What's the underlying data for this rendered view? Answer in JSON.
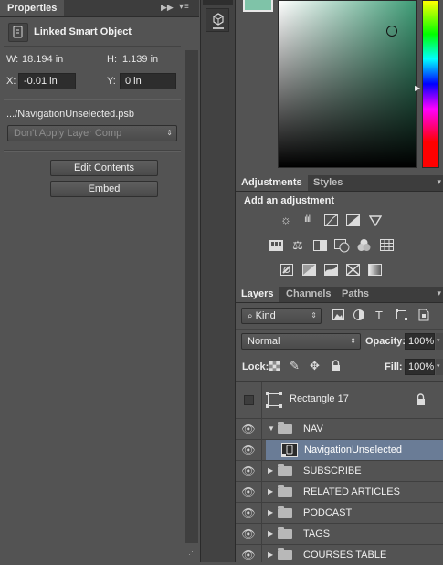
{
  "properties": {
    "tab_label": "Properties",
    "object_type": "Linked Smart Object",
    "w_label": "W:",
    "w_value": "18.194 in",
    "h_label": "H:",
    "h_value": "1.139 in",
    "x_label": "X:",
    "x_value": "-0.01 in",
    "y_label": "Y:",
    "y_value": "0 in",
    "file_name": ".../NavigationUnselected.psb",
    "layer_comp": "Don't Apply Layer Comp",
    "edit_contents_label": "Edit Contents",
    "embed_label": "Embed"
  },
  "adjustments": {
    "tabs": [
      "Adjustments",
      "Styles"
    ],
    "heading": "Add an adjustment",
    "row1": [
      "brightness-icon",
      "levels-icon",
      "curves-icon",
      "exposure-icon",
      "vibrance-icon"
    ],
    "row2": [
      "hue-saturation-icon",
      "color-balance-icon",
      "black-white-icon",
      "photo-filter-icon",
      "channel-mixer-icon",
      "color-lookup-icon"
    ],
    "row3": [
      "invert-icon",
      "posterize-icon",
      "threshold-icon",
      "selective-color-icon",
      "gradient-map-icon"
    ]
  },
  "layers": {
    "tabs": [
      "Layers",
      "Channels",
      "Paths"
    ],
    "filter_label": "Kind",
    "blend_mode": "Normal",
    "opacity_label": "Opacity:",
    "opacity_value": "100%",
    "lock_label": "Lock:",
    "fill_label": "Fill:",
    "fill_value": "100%",
    "items": [
      {
        "name": "Rectangle 17",
        "kind": "shape",
        "visible": false,
        "locked": true
      },
      {
        "name": "NAV",
        "kind": "group",
        "expanded": true
      },
      {
        "name": "NavigationUnselected",
        "kind": "smart-object",
        "selected": true
      },
      {
        "name": "SUBSCRIBE",
        "kind": "group"
      },
      {
        "name": "RELATED ARTICLES",
        "kind": "group"
      },
      {
        "name": "PODCAST",
        "kind": "group"
      },
      {
        "name": "TAGS",
        "kind": "group"
      },
      {
        "name": "COURSES TABLE",
        "kind": "group"
      }
    ]
  },
  "colors": {
    "selected_row": "#6a7c96",
    "panel": "#535353",
    "field": "#2d2d2d"
  }
}
